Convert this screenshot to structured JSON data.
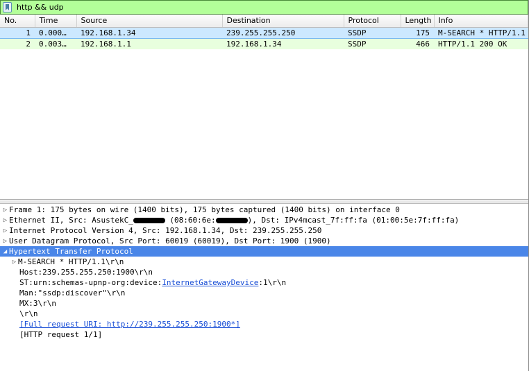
{
  "filter": {
    "value": "http && udp"
  },
  "packetList": {
    "columns": [
      "No.",
      "Time",
      "Source",
      "Destination",
      "Protocol",
      "Length",
      "Info"
    ],
    "rows": [
      {
        "no": "1",
        "time": "0.000…",
        "src": "192.168.1.34",
        "dst": "239.255.255.250",
        "proto": "SSDP",
        "len": "175",
        "info": "M-SEARCH * HTTP/1.1",
        "selected": true
      },
      {
        "no": "2",
        "time": "0.003…",
        "src": "192.168.1.1",
        "dst": "192.168.1.34",
        "proto": "SSDP",
        "len": "466",
        "info": "HTTP/1.1 200 OK",
        "selected": false
      }
    ]
  },
  "details": {
    "frame": "Frame 1: 175 bytes on wire (1400 bits), 175 bytes captured (1400 bits) on interface 0",
    "eth_prefix": "Ethernet II, Src: AsustekC_",
    "eth_mid1": " (08:60:6e:",
    "eth_suffix": "), Dst: IPv4mcast_7f:ff:fa (01:00:5e:7f:ff:fa)",
    "ip": "Internet Protocol Version 4, Src: 192.168.1.34, Dst: 239.255.255.250",
    "udp": "User Datagram Protocol, Src Port: 60019 (60019), Dst Port: 1900 (1900)",
    "http": "Hypertext Transfer Protocol",
    "msearch": "M-SEARCH * HTTP/1.1\\r\\n",
    "host": "Host:239.255.255.250:1900\\r\\n",
    "st_prefix": "ST:urn:schemas-upnp-org:device:",
    "st_link": "InternetGatewayDevice",
    "st_suffix": ":1\\r\\n",
    "man": "Man:\"ssdp:discover\"\\r\\n",
    "mx": "MX:3\\r\\n",
    "crlf": "\\r\\n",
    "fulluri": "[Full request URI: http://239.255.255.250:1900*]",
    "reqnum": "[HTTP request 1/1]"
  }
}
